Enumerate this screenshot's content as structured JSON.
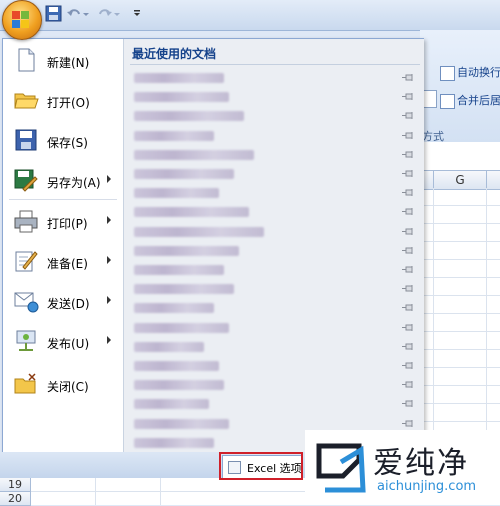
{
  "app": {
    "name": "Excel"
  },
  "menu": {
    "items": [
      {
        "label": "新建(N)",
        "icon": "new-document-icon",
        "has_arrow": false
      },
      {
        "label": "打开(O)",
        "icon": "open-folder-icon",
        "has_arrow": false
      },
      {
        "label": "保存(S)",
        "icon": "save-icon",
        "has_arrow": false
      },
      {
        "label": "另存为(A)",
        "icon": "save-as-icon",
        "has_arrow": true
      },
      {
        "label": "打印(P)",
        "icon": "print-icon",
        "has_arrow": true
      },
      {
        "label": "准备(E)",
        "icon": "prepare-icon",
        "has_arrow": true
      },
      {
        "label": "发送(D)",
        "icon": "send-icon",
        "has_arrow": true
      },
      {
        "label": "发布(U)",
        "icon": "publish-icon",
        "has_arrow": true
      },
      {
        "label": "关闭(C)",
        "icon": "close-document-icon",
        "has_arrow": false
      }
    ],
    "recent_title": "最近使用的文档",
    "recent_count": 20,
    "options_label": "Excel 选项"
  },
  "ribbon": {
    "wrap_text": "自动换行",
    "merge_center": "合并后居",
    "group_label": "方式"
  },
  "sheet": {
    "column_g": "G",
    "rows": [
      "19",
      "20"
    ]
  },
  "watermark": {
    "title": "爱纯净",
    "url": "aichunjing.com"
  },
  "colors": {
    "accent": "#15428b",
    "highlight_box": "#d0202a",
    "watermark_url": "#2c8fd8"
  }
}
